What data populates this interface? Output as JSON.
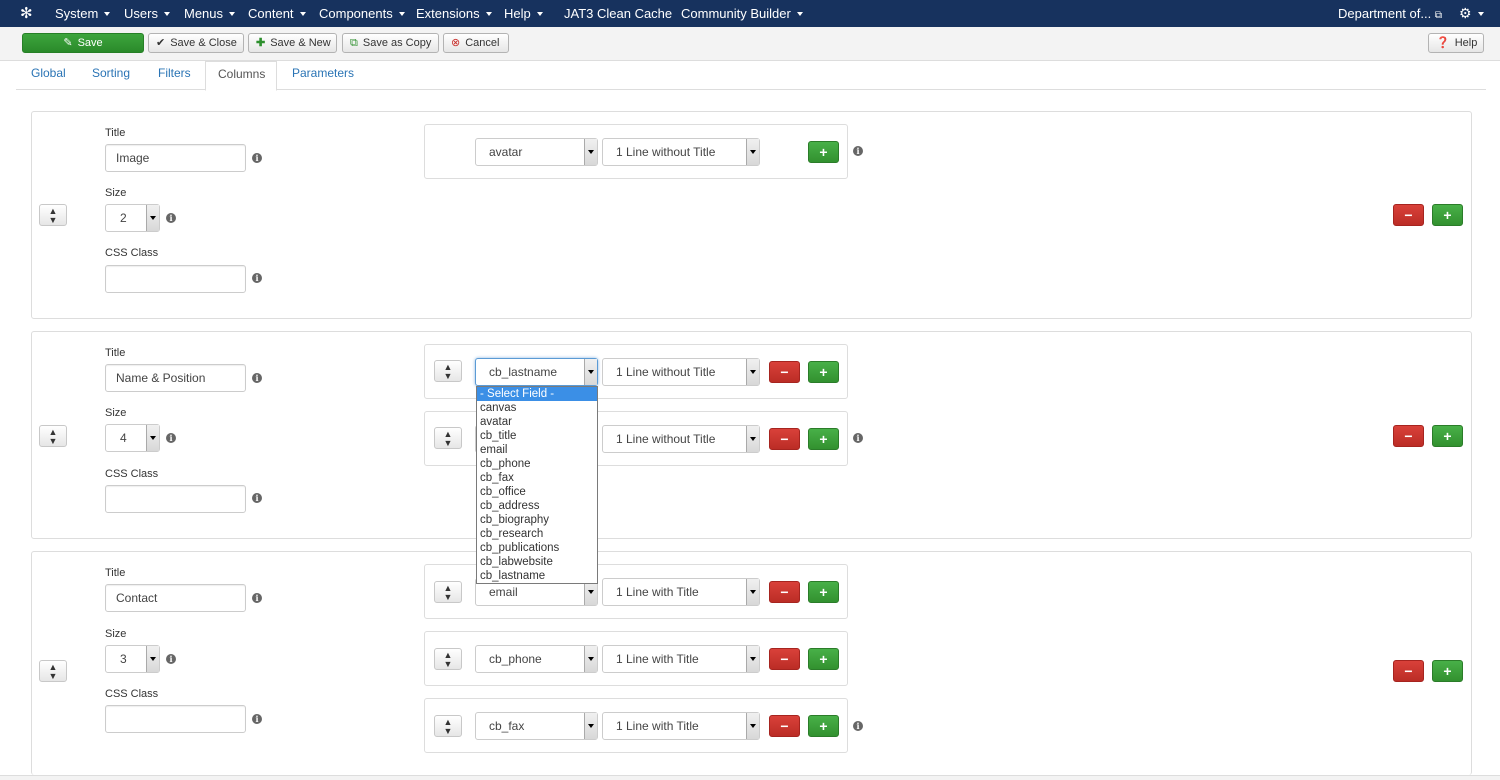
{
  "navbar": {
    "logo_icon": "joomla-logo-icon",
    "menus": [
      "System",
      "Users",
      "Menus",
      "Content",
      "Components",
      "Extensions",
      "Help"
    ],
    "plain_items": [
      "JAT3 Clean Cache",
      "Community Builder"
    ],
    "site_link": "Department of...",
    "settings_icon": "gear-icon",
    "color": "#17325e"
  },
  "toolbar": {
    "save": "Save",
    "save_close": "Save & Close",
    "save_new": "Save & New",
    "save_copy": "Save as Copy",
    "cancel": "Cancel",
    "help": "Help"
  },
  "tabs": [
    "Global",
    "Sorting",
    "Filters",
    "Columns",
    "Parameters"
  ],
  "active_tab": "Columns",
  "labels": {
    "title": "Title",
    "size": "Size",
    "css_class": "CSS Class"
  },
  "columns": [
    {
      "title": "Image",
      "size": "2",
      "css_class": "",
      "fields": [
        {
          "field": "avatar",
          "format": "1 Line without Title"
        }
      ]
    },
    {
      "title": "Name & Position",
      "size": "4",
      "css_class": "",
      "fields": [
        {
          "field": "cb_lastname",
          "format": "1 Line without Title"
        },
        {
          "field": "",
          "format": "1 Line without Title"
        }
      ]
    },
    {
      "title": "Contact",
      "size": "3",
      "css_class": "",
      "fields": [
        {
          "field": "email",
          "format": "1 Line with Title"
        },
        {
          "field": "cb_phone",
          "format": "1 Line with Title"
        },
        {
          "field": "cb_fax",
          "format": "1 Line with Title"
        }
      ]
    }
  ],
  "field_dropdown": {
    "selected_highlight": "- Select Field -",
    "options": [
      "- Select Field -",
      "canvas",
      "avatar",
      "cb_title",
      "email",
      "cb_phone",
      "cb_fax",
      "cb_office",
      "cb_address",
      "cb_biography",
      "cb_research",
      "cb_publications",
      "cb_labwebsite",
      "cb_lastname"
    ]
  },
  "colors": {
    "green": "#3da53d",
    "red": "#c9302c",
    "link": "#2a74b5",
    "highlight": "#3b8fe6"
  }
}
